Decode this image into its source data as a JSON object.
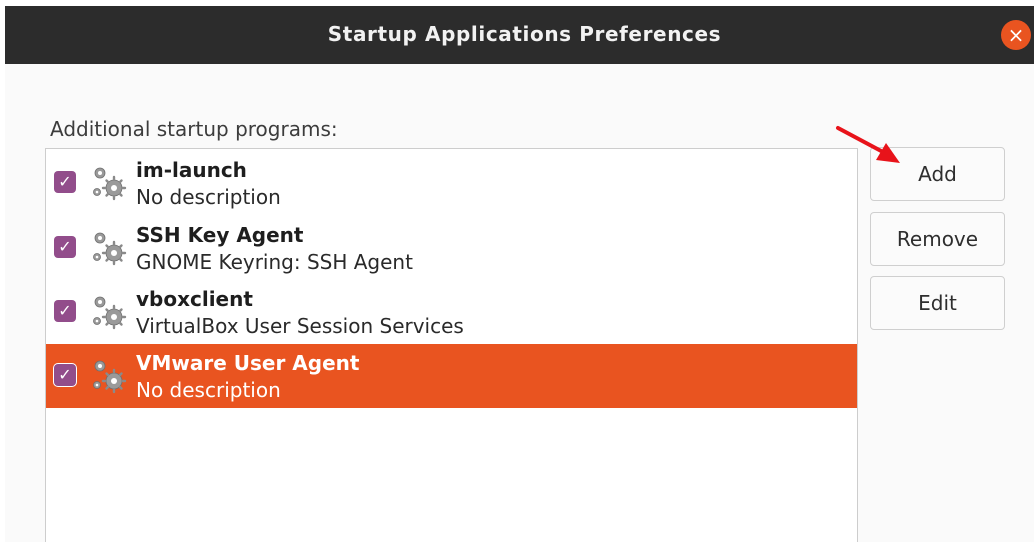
{
  "window": {
    "title": "Startup Applications Preferences",
    "close_symbol": "×"
  },
  "section_label": "Additional startup programs:",
  "programs": [
    {
      "name": "im-launch",
      "description": "No description",
      "enabled": true,
      "selected": false,
      "icon": "gear-icon"
    },
    {
      "name": "SSH Key Agent",
      "description": "GNOME Keyring: SSH Agent",
      "enabled": true,
      "selected": false,
      "icon": "gear-icon"
    },
    {
      "name": "vboxclient",
      "description": "VirtualBox User Session Services",
      "enabled": true,
      "selected": false,
      "icon": "gear-icon"
    },
    {
      "name": "VMware User Agent",
      "description": "No description",
      "enabled": true,
      "selected": true,
      "icon": "gear-icon"
    }
  ],
  "buttons": {
    "add": "Add",
    "remove": "Remove",
    "edit": "Edit"
  },
  "colors": {
    "accent": "#e95420",
    "checkbox": "#924d8b",
    "annotation_arrow": "#e8131a"
  }
}
